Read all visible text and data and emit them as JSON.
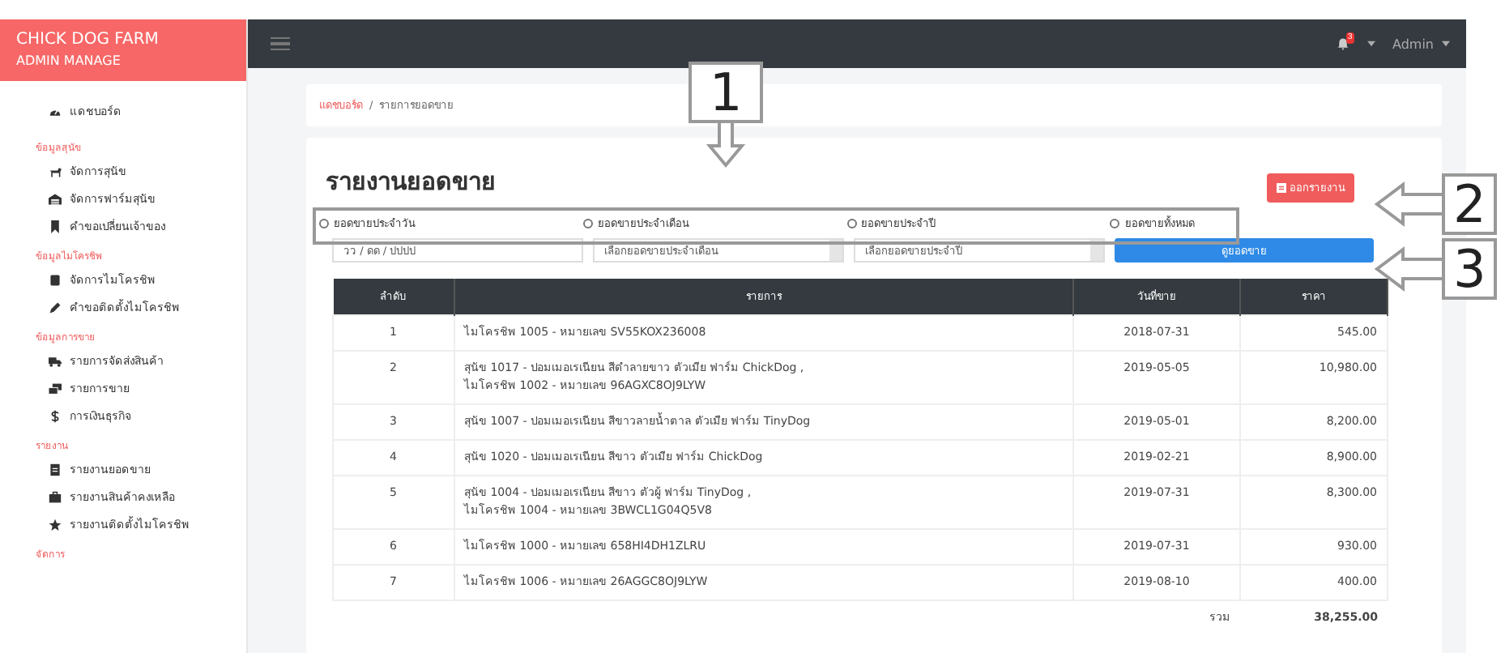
{
  "brand": {
    "title": "CHICK DOG FARM",
    "subtitle": "ADMIN MANAGE"
  },
  "sidebar": {
    "top_item": {
      "label": "แดชบอร์ด"
    },
    "sections": [
      {
        "heading": "ข้อมูลสุนัข",
        "items": [
          {
            "label": "จัดการสุนัข"
          },
          {
            "label": "จัดการฟาร์มสุนัข"
          },
          {
            "label": "คำขอเปลี่ยนเจ้าของ"
          }
        ]
      },
      {
        "heading": "ข้อมูลไมโครชิพ",
        "items": [
          {
            "label": "จัดการไมโครชิพ"
          },
          {
            "label": "คำขอติดตั้งไมโครชิพ"
          }
        ]
      },
      {
        "heading": "ข้อมูลการขาย",
        "items": [
          {
            "label": "รายการจัดส่งสินค้า"
          },
          {
            "label": "รายการขาย"
          },
          {
            "label": "การเงินธุรกิจ"
          }
        ]
      },
      {
        "heading": "รายงาน",
        "items": [
          {
            "label": "รายงานยอดขาย"
          },
          {
            "label": "รายงานสินค้าคงเหลือ"
          },
          {
            "label": "รายงานติดตั้งไมโครชิพ"
          }
        ]
      },
      {
        "heading": "จัดการ"
      }
    ]
  },
  "topbar": {
    "notification_count": "3",
    "user": "Admin"
  },
  "breadcrumb": {
    "separator": "/",
    "items": [
      {
        "label": "แดชบอร์ด",
        "kind": "link"
      },
      {
        "label": "รายการยอดขาย",
        "kind": "current"
      }
    ]
  },
  "page_title": "รายงานยอดขาย",
  "export_button": "ออกรายงาน",
  "report_types": [
    {
      "label": "ยอดขายประจำวัน",
      "selected": false
    },
    {
      "label": "ยอดขายประจำเดือน",
      "selected": false
    },
    {
      "label": "ยอดขายประจำปี",
      "selected": false
    },
    {
      "label": "ยอดขายทั้งหมด",
      "selected": false
    }
  ],
  "filters": {
    "date": {
      "placeholder": "วว / ดด / ปปปป"
    },
    "month": "เลือกยอดขายประจำเดือน",
    "year": "เลือกยอดขายประจำปี"
  },
  "view_button": "ดูยอดขาย",
  "table": {
    "columns": [
      "ลำดับ",
      "รายการ",
      "วันที่ขาย",
      "ราคา"
    ],
    "rows": [
      {
        "no": "1",
        "item": [
          "ไมโครชิพ 1005 - หมายเลข SV55KOX236008"
        ],
        "date": "2018-07-31",
        "price": "545.00"
      },
      {
        "no": "2",
        "item": [
          "สุนัข 1017 - ปอมเมอเรเนียน สีดำลายขาว ตัวเมีย ฟาร์ม ChickDog ,",
          "ไมโครชิพ 1002 - หมายเลข 96AGXC8OJ9LYW"
        ],
        "date": "2019-05-05",
        "price": "10,980.00"
      },
      {
        "no": "3",
        "item": [
          "สุนัข 1007 - ปอมเมอเรเนียน สีขาวลายน้ำตาล ตัวเมีย ฟาร์ม TinyDog"
        ],
        "date": "2019-05-01",
        "price": "8,200.00"
      },
      {
        "no": "4",
        "item": [
          "สุนัข 1020 - ปอมเมอเรเนียน สีขาว ตัวเมีย ฟาร์ม ChickDog"
        ],
        "date": "2019-02-21",
        "price": "8,900.00"
      },
      {
        "no": "5",
        "item": [
          "สุนัข 1004 - ปอมเมอเรเนียน สีขาว ตัวผู้ ฟาร์ม TinyDog ,",
          "ไมโครชิพ 1004 - หมายเลข 3BWCL1G04Q5V8"
        ],
        "date": "2019-07-31",
        "price": "8,300.00"
      },
      {
        "no": "6",
        "item": [
          "ไมโครชิพ 1000 - หมายเลข 658HI4DH1ZLRU"
        ],
        "date": "2019-07-31",
        "price": "930.00"
      },
      {
        "no": "7",
        "item": [
          "ไมโครชิพ 1006 - หมายเลข 26AGGC8OJ9LYW"
        ],
        "date": "2019-08-10",
        "price": "400.00"
      }
    ],
    "total_label": "รวม",
    "total": "38,255.00"
  },
  "annotations": [
    {
      "label": "1"
    },
    {
      "label": "2"
    },
    {
      "label": "3"
    }
  ]
}
